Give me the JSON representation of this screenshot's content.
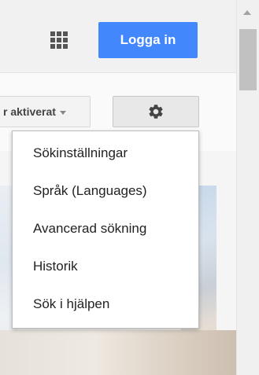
{
  "header": {
    "apps_icon": "apps-grid-icon",
    "login_label": "Logga in",
    "login_color": "#4387fd"
  },
  "toolbar": {
    "safesearch_label": "r aktiverat",
    "settings_icon": "gear-icon"
  },
  "settings_menu": {
    "items": [
      {
        "label": "Sökinställningar"
      },
      {
        "label": "Språk (Languages)"
      },
      {
        "label": "Avancerad sökning"
      },
      {
        "label": "Historik"
      },
      {
        "label": "Sök i hjälpen"
      }
    ]
  }
}
